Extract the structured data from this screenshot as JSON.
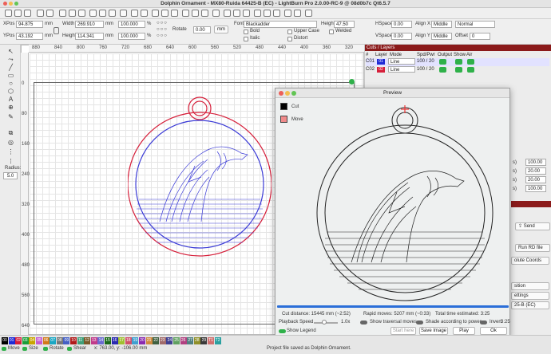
{
  "window": {
    "title": "Dolphin Ornament - MX80-Ruida 64425-B (EC) - LightBurn Pro 2.0.00-RC-9 @ 08d0b7c Qt6.5.7"
  },
  "props": {
    "xpos_label": "XPos",
    "xpos": "94.875",
    "ypos_label": "YPos",
    "ypos": "43.192",
    "unit": "mm",
    "width_label": "Width",
    "width": "269.910",
    "height_label": "Height",
    "height": "114.341",
    "scale_w": "100.000",
    "scale_h": "100.000",
    "pct": "%",
    "rotate_label": "Rotate",
    "rotate": "0.00",
    "rotate_unit": "mm",
    "font_label": "Font",
    "font": "Blackadder",
    "height2_label": "Height",
    "height2": "47.50",
    "hspace_label": "HSpace",
    "hspace": "0.00",
    "vspace_label": "VSpace",
    "vspace": "0.00",
    "alignx_label": "Align X",
    "alignx": "Middle",
    "aligny_label": "Align Y",
    "aligny": "Middle",
    "normal": "Normal",
    "offset_label": "Offset",
    "offset": "0",
    "bold": "Bold",
    "italic": "Italic",
    "upper": "Upper Case",
    "distort": "Distort",
    "welded": "Welded"
  },
  "ruler": {
    "top": [
      "880",
      "840",
      "800",
      "760",
      "720",
      "680",
      "640",
      "600",
      "560",
      "520",
      "480",
      "440",
      "400",
      "360",
      "320"
    ],
    "left": [
      "0",
      "80",
      "160",
      "240",
      "320",
      "400",
      "480",
      "560",
      "640"
    ]
  },
  "cuts": {
    "title": "Cuts / Layers",
    "headers": [
      "#",
      "Layer",
      "Mode",
      "Spd/Pwr",
      "Output",
      "Show",
      "Air"
    ],
    "rows": [
      {
        "num": "C01",
        "layer": "01",
        "mode": "Line",
        "spd": "100 / 20",
        "color": "#1f2bd6"
      },
      {
        "num": "C02",
        "layer": "02",
        "mode": "Line",
        "spd": "100 / 20",
        "color": "#d61f3a"
      }
    ]
  },
  "rightside": {
    "vals": [
      "100.00",
      "20.00",
      "20.00",
      "100.00"
    ],
    "send": "Send",
    "run_rd": "Run RD file",
    "abs_coords": "olute Coords",
    "position": "sition",
    "settings": "ettings",
    "device": "25-B (EC)"
  },
  "left": {
    "radius_label": "Radius:",
    "radius": "5.0"
  },
  "preview": {
    "title": "Preview",
    "legend": [
      {
        "label": "Cut",
        "color": "#000000"
      },
      {
        "label": "Move",
        "color": "#f08a8a"
      }
    ],
    "cut_distance": "Cut distance: 15445 mm (~2:52)",
    "rapid_moves": "Rapid moves: 5207 mm (~0:33)",
    "total_time": "Total time estimated: 3:25",
    "playback_label": "Playback Speed",
    "playback_speed": "1.0x",
    "show_traversal": "Show traversal moves",
    "shade": "Shade according to power",
    "invert": "Invert",
    "time_right": "3:25",
    "show_legend": "Show Legend",
    "start_here": "Start here",
    "save_image": "Save Image",
    "play": "Play",
    "ok": "Ok"
  },
  "status": {
    "move": "Move",
    "size": "Size",
    "rotate": "Rotate",
    "shear": "Shear",
    "coords": "x: 763.00, y: -106.00 mm",
    "message": "Project file saved as Dolphin Ornament.",
    "palette": [
      "00",
      "01",
      "02",
      "03",
      "04",
      "05",
      "06",
      "07",
      "08",
      "09",
      "10",
      "11",
      "12",
      "13",
      "14",
      "15",
      "16",
      "17",
      "18",
      "19",
      "20",
      "21",
      "22",
      "23",
      "24",
      "25",
      "26",
      "27",
      "28",
      "29",
      "T1",
      "T2"
    ],
    "palette_colors": [
      "#000000",
      "#1f2bd6",
      "#d61f3a",
      "#1a9e3a",
      "#c8a500",
      "#c45bd0",
      "#d27a1a",
      "#1aa7c4",
      "#777777",
      "#4460c4",
      "#b01a1a",
      "#3fa07a",
      "#7a5a2a",
      "#c03a8a",
      "#6a6ad0",
      "#1a6a1a",
      "#2a2ab0",
      "#a0c030",
      "#d0506a",
      "#40a0d0",
      "#8a2ab0",
      "#d08a40",
      "#406040",
      "#a06a6a",
      "#404090",
      "#60a060",
      "#b04080",
      "#508080",
      "#90902a",
      "#3a3a3a",
      "#d07070",
      "#2aa0a0"
    ]
  }
}
